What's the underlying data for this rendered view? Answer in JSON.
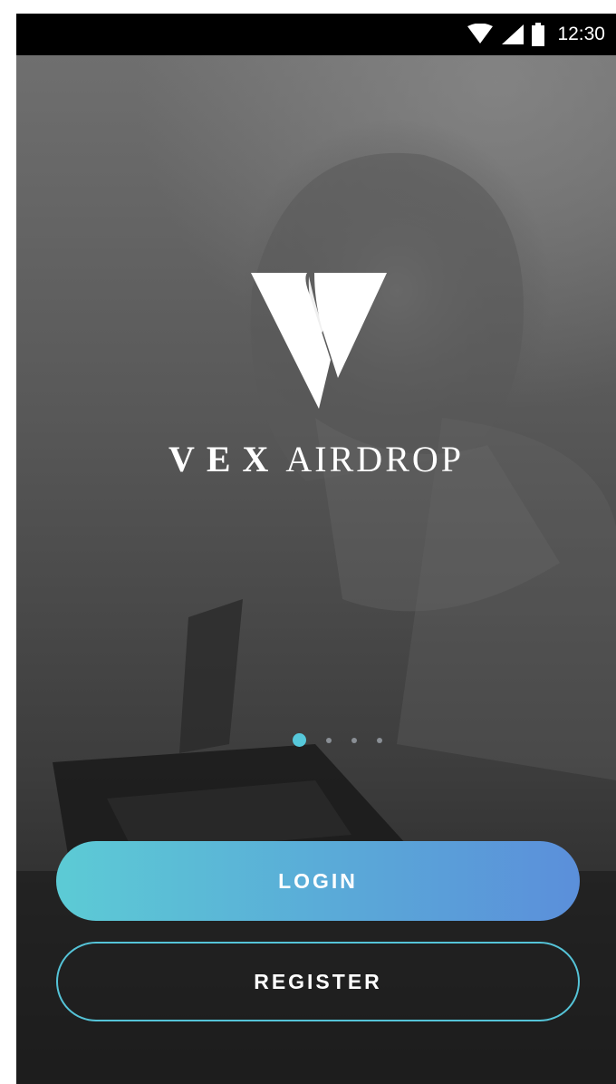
{
  "status_bar": {
    "time": "12:30",
    "icons": [
      "wifi-icon",
      "signal-icon",
      "battery-icon"
    ]
  },
  "brand": {
    "logo_icon": "v-logo-icon",
    "name_part1": "VEX",
    "name_part2": "AIRDROP"
  },
  "carousel": {
    "page_count": 4,
    "active_index": 0
  },
  "actions": {
    "login_label": "LOGIN",
    "register_label": "REGISTER"
  },
  "colors": {
    "accent": "#56c8da",
    "login_gradient_start": "#5ccbd5",
    "login_gradient_end": "#5b8fda",
    "status_bar": "#000000"
  }
}
